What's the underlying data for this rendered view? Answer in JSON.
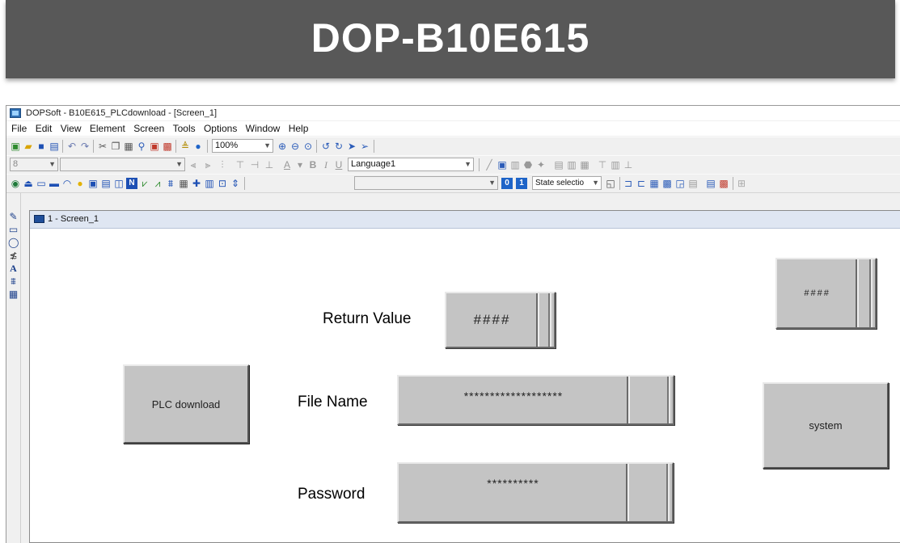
{
  "banner": {
    "title": "DOP-B10E615"
  },
  "window": {
    "title": "DOPSoft - B10E615_PLCdownload - [Screen_1]"
  },
  "menu": [
    "File",
    "Edit",
    "View",
    "Element",
    "Screen",
    "Tools",
    "Options",
    "Window",
    "Help"
  ],
  "toolbar": {
    "zoom": "100%",
    "font_size": "8",
    "language": "Language1",
    "state_select": "State selectio",
    "tb1_icons": [
      "new-icon",
      "open-icon",
      "save-icon",
      "save-all-icon",
      "undo-icon",
      "redo-icon",
      "cut-icon",
      "copy-icon",
      "paste-icon",
      "find-icon",
      "compile-icon",
      "download-icon",
      "upload-icon",
      "info-icon",
      "zoom-in-icon",
      "zoom-out-icon",
      "zoom-fit-icon",
      "rotate-left-icon",
      "rotate-right-icon",
      "pointer-icon"
    ],
    "tb3_icons": [
      "button-icon",
      "lamp-icon",
      "meter-icon",
      "bar-icon",
      "pipe-icon",
      "circle-icon",
      "numeric-icon",
      "display-icon",
      "numeric-entry-icon",
      "trend-icon",
      "xy-chart-icon",
      "alarm-icon",
      "keypad-icon",
      "cross-icon",
      "table-icon",
      "folder-icon",
      "menu-icon"
    ]
  },
  "doc_tab": {
    "label": "1 - Screen_1"
  },
  "screen": {
    "return_value_label": "Return Value",
    "return_value_display": "####",
    "file_name_label": "File Name",
    "file_name_value": "*******************",
    "password_label": "Password",
    "password_value": "**********",
    "plc_download_button": "PLC download",
    "status_display": "####",
    "system_button": "system"
  }
}
